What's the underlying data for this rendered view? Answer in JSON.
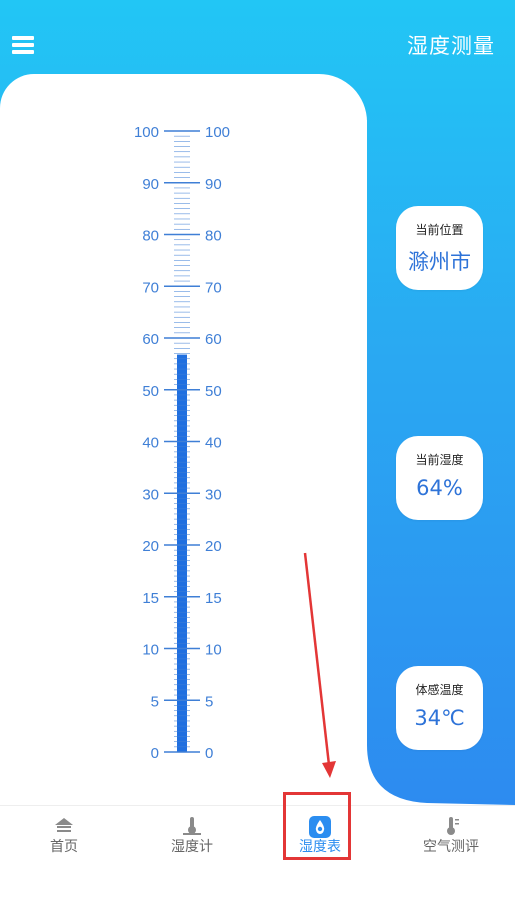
{
  "header": {
    "title": "湿度测量",
    "menu_icon": "menu-icon"
  },
  "gauge": {
    "labels_left": [
      "100",
      "90",
      "80",
      "70",
      "60",
      "50",
      "40",
      "30",
      "20",
      "15",
      "10",
      "5",
      "0"
    ],
    "labels_right": [
      "100",
      "90",
      "80",
      "70",
      "60",
      "50",
      "40",
      "30",
      "20",
      "15",
      "10",
      "5",
      "0"
    ],
    "level_percent": 64,
    "fill_color": "#1f6fe0",
    "tick_color": "#3f7fd6"
  },
  "info": {
    "location": {
      "label": "当前位置",
      "value": "滁州市"
    },
    "humidity": {
      "label": "当前湿度",
      "value": "64%"
    },
    "feels": {
      "label": "体感温度",
      "value": "34℃"
    }
  },
  "tabs": [
    {
      "label": "首页",
      "icon": "home-icon"
    },
    {
      "label": "湿度计",
      "icon": "hygrometer-icon"
    },
    {
      "label": "湿度表",
      "icon": "humidity-table-icon",
      "active": true
    },
    {
      "label": "空气测评",
      "icon": "air-quality-icon"
    }
  ],
  "colors": {
    "accent": "#2b8df0",
    "highlight": "#e33636"
  }
}
